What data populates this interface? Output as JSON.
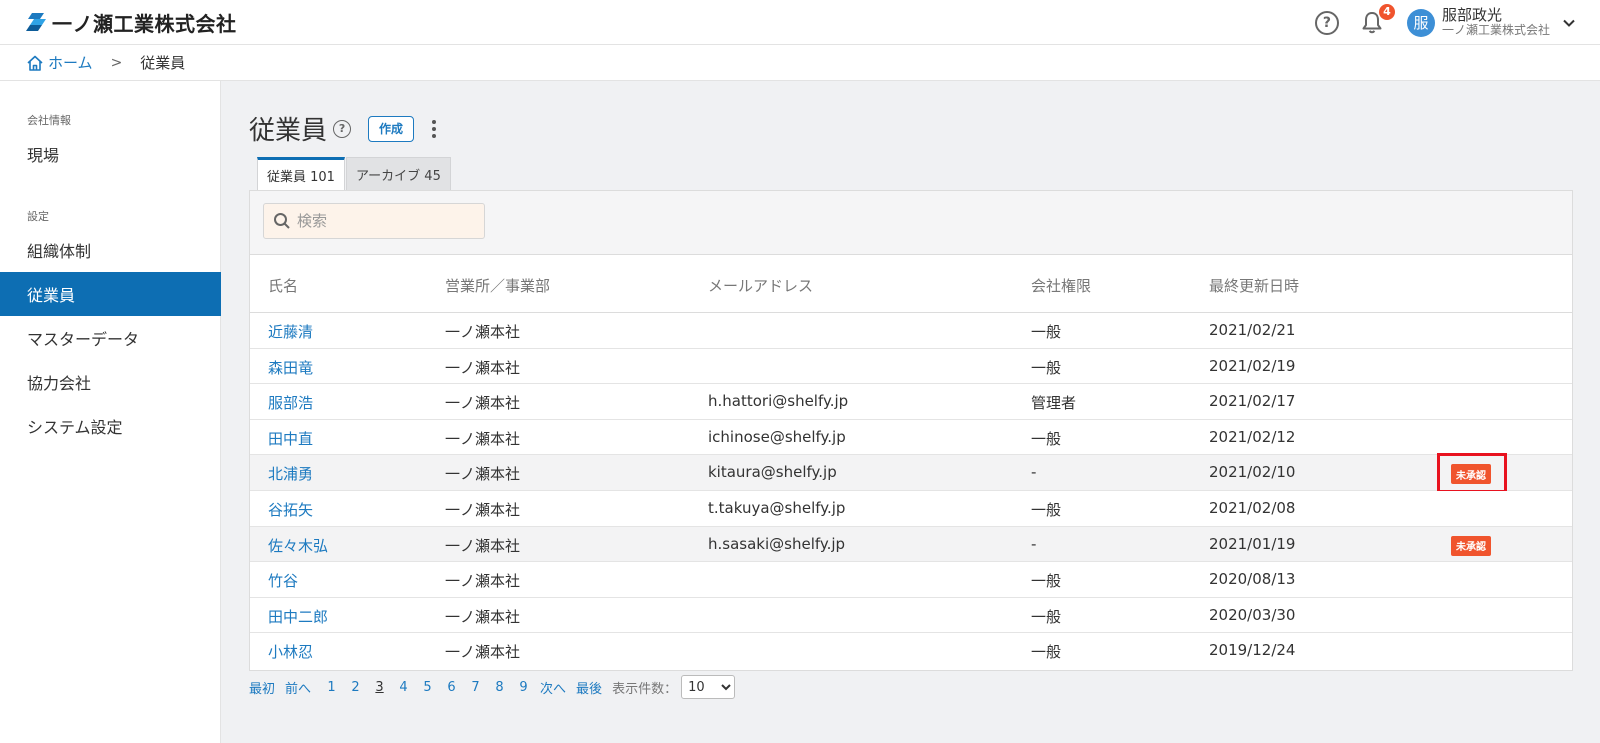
{
  "header": {
    "company_name": "一ノ瀬工業株式会社",
    "notification_count": "4",
    "user": {
      "avatar_initial": "服",
      "name": "服部政光",
      "company": "一ノ瀬工業株式会社"
    }
  },
  "breadcrumb": {
    "home": "ホーム",
    "separator": ">",
    "current": "従業員"
  },
  "sidebar": {
    "section_company": "会社情報",
    "item_site": "現場",
    "section_settings": "設定",
    "items": [
      {
        "label": "組織体制"
      },
      {
        "label": "従業員"
      },
      {
        "label": "マスターデータ"
      },
      {
        "label": "協力会社"
      },
      {
        "label": "システム設定"
      }
    ]
  },
  "main": {
    "title": "従業員",
    "help_glyph": "?",
    "create_button": "作成",
    "tabs": [
      {
        "label": "従業員 101"
      },
      {
        "label": "アーカイブ 45"
      }
    ],
    "search_placeholder": "検索",
    "columns": [
      "氏名",
      "営業所／事業部",
      "メールアドレス",
      "会社権限",
      "最終更新日時"
    ],
    "rows": [
      {
        "name": "近藤清",
        "office": "一ノ瀬本社",
        "email": "",
        "role": "一般",
        "updated": "2021/02/21",
        "badge": ""
      },
      {
        "name": "森田竜",
        "office": "一ノ瀬本社",
        "email": "",
        "role": "一般",
        "updated": "2021/02/19",
        "badge": ""
      },
      {
        "name": "服部浩",
        "office": "一ノ瀬本社",
        "email": "h.hattori@shelfy.jp",
        "role": "管理者",
        "updated": "2021/02/17",
        "badge": ""
      },
      {
        "name": "田中直",
        "office": "一ノ瀬本社",
        "email": "ichinose@shelfy.jp",
        "role": "一般",
        "updated": "2021/02/12",
        "badge": ""
      },
      {
        "name": "北浦勇",
        "office": "一ノ瀬本社",
        "email": "kitaura@shelfy.jp",
        "role": "-",
        "updated": "2021/02/10",
        "badge": "未承認"
      },
      {
        "name": "谷拓矢",
        "office": "一ノ瀬本社",
        "email": "t.takuya@shelfy.jp",
        "role": "一般",
        "updated": "2021/02/08",
        "badge": ""
      },
      {
        "name": "佐々木弘",
        "office": "一ノ瀬本社",
        "email": "h.sasaki@shelfy.jp",
        "role": "-",
        "updated": "2021/01/19",
        "badge": "未承認"
      },
      {
        "name": "竹谷",
        "office": "一ノ瀬本社",
        "email": "",
        "role": "一般",
        "updated": "2020/08/13",
        "badge": ""
      },
      {
        "name": "田中二郎",
        "office": "一ノ瀬本社",
        "email": "",
        "role": "一般",
        "updated": "2020/03/30",
        "badge": ""
      },
      {
        "name": "小林忍",
        "office": "一ノ瀬本社",
        "email": "",
        "role": "一般",
        "updated": "2019/12/24",
        "badge": ""
      }
    ]
  },
  "pagination": {
    "first": "最初",
    "prev": "前へ",
    "pages": [
      "1",
      "2",
      "3",
      "4",
      "5",
      "6",
      "7",
      "8",
      "9"
    ],
    "current_page": "3",
    "next": "次へ",
    "last": "最後",
    "per_page_label": "表示件数：",
    "per_page_value": "10"
  },
  "colors": {
    "accent": "#0d6eb3",
    "link": "#1d7ac0",
    "badge": "#f0542d",
    "highlight": "#e8121f"
  }
}
